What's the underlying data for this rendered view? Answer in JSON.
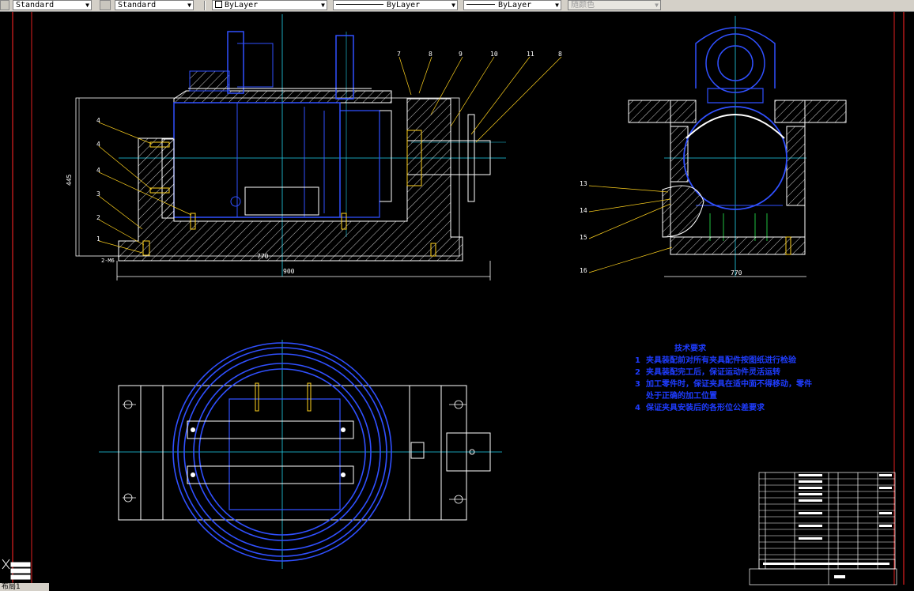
{
  "toolbar": {
    "text_style": "Standard",
    "dim_style": "Standard",
    "layer": "ByLayer",
    "linetype": "ByLayer",
    "lineweight": "ByLayer",
    "plot_style": "随颜色"
  },
  "drawing": {
    "dims": {
      "width_top": "900",
      "width_inner": "770",
      "height_left": "445",
      "right_width": "770",
      "small_dim": "2-M6"
    },
    "callouts_top": [
      "7",
      "8",
      "9",
      "10",
      "11",
      "8"
    ],
    "callouts_left": [
      "4",
      "4",
      "4",
      "3",
      "2",
      "1"
    ],
    "callouts_right": [
      "13",
      "14",
      "15",
      "16"
    ]
  },
  "tech_notes": {
    "title": "技术要求",
    "items": [
      {
        "num": "1",
        "text": "夹具装配前对所有夹具配件按图纸进行检验"
      },
      {
        "num": "2",
        "text": "夹具装配完工后，保证运动件灵活运转"
      },
      {
        "num": "3",
        "text": "加工零件时，保证夹具在适中面不得移动，零件",
        "cont": "处于正确的加工位置"
      },
      {
        "num": "4",
        "text": "保证夹具安装后的各形位公差要求"
      }
    ]
  },
  "status": {
    "layout_tab": "布局1"
  }
}
